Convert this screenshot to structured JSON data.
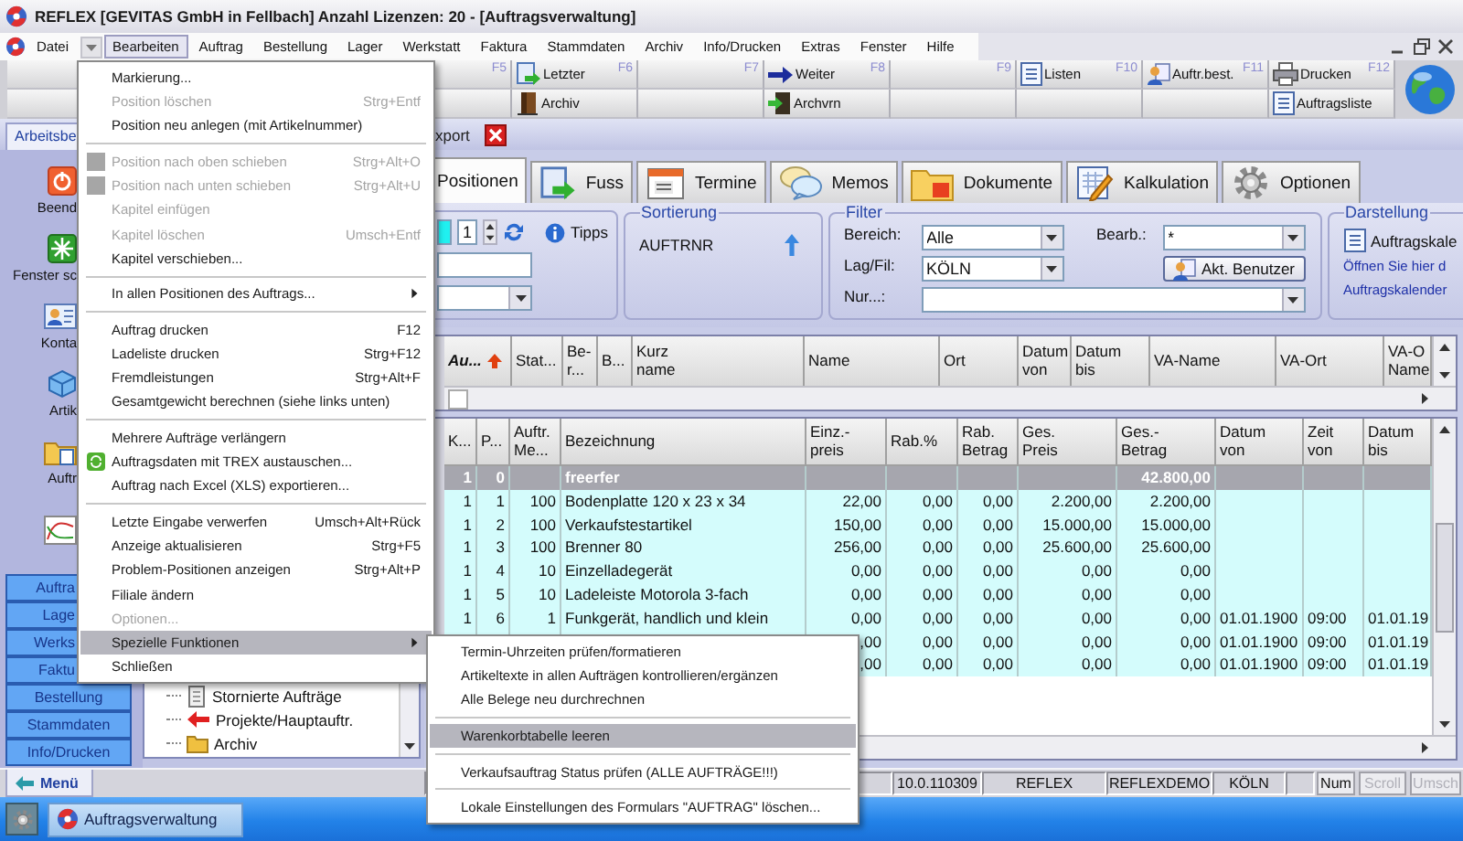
{
  "window": {
    "title": "REFLEX [GEVITAS GmbH in Fellbach] Anzahl Lizenzen: 20 - [Auftragsverwaltung]"
  },
  "menu_bar": {
    "items": [
      {
        "label": "Datei",
        "selected": false
      },
      {
        "label": "Bearbeiten",
        "selected": true
      },
      {
        "label": "Auftrag",
        "selected": false
      },
      {
        "label": "Bestellung",
        "selected": false
      },
      {
        "label": "Lager",
        "selected": false
      },
      {
        "label": "Werkstatt",
        "selected": false
      },
      {
        "label": "Faktura",
        "selected": false
      },
      {
        "label": "Stammdaten",
        "selected": false
      },
      {
        "label": "Archiv",
        "selected": false
      },
      {
        "label": "Info/Drucken",
        "selected": false
      },
      {
        "label": "Extras",
        "selected": false
      },
      {
        "label": "Fenster",
        "selected": false
      },
      {
        "label": "Hilfe",
        "selected": false
      }
    ]
  },
  "toolbar": [
    {
      "key": "F5"
    },
    {
      "key": "F6",
      "top": "Letzter",
      "bottom": "Archiv"
    },
    {
      "key": "F7"
    },
    {
      "key": "F8",
      "top": "Weiter",
      "bottom": "Archvrn"
    },
    {
      "key": "F9"
    },
    {
      "key": "F10",
      "top": "Listen"
    },
    {
      "key": "F11",
      "top": "Auftr.best."
    },
    {
      "key": "F12",
      "top": "Drucken",
      "bottom": "Auftragsliste"
    }
  ],
  "form_bar": {
    "sidebar_tab": "Arbeitsbe",
    "items": [
      "xport"
    ]
  },
  "sidebar": {
    "tools": [
      "Beend",
      "Fenster sc",
      "Konta",
      "Artik",
      "Auftr"
    ],
    "modules": [
      "Auftra",
      "Lage",
      "Werks",
      "Faktu",
      "Bestellung",
      "Stammdaten",
      "Info/Drucken"
    ]
  },
  "tree": {
    "items": [
      "Stornierte Aufträge",
      "Projekte/Hauptauftr.",
      "Archiv"
    ]
  },
  "tabs": [
    {
      "label": "Positionen",
      "selected": true
    },
    {
      "label": "Fuss",
      "selected": false
    },
    {
      "label": "Termine",
      "selected": false
    },
    {
      "label": "Memos",
      "selected": false
    },
    {
      "label": "Dokumente",
      "selected": false
    },
    {
      "label": "Kalkulation",
      "selected": false
    },
    {
      "label": "Optionen",
      "selected": false
    }
  ],
  "quick_panel": {
    "counter": "1",
    "tips": "Tipps"
  },
  "sorting": {
    "title": "Sortierung",
    "field": "AUFTRNR"
  },
  "filter": {
    "title": "Filter",
    "fields": [
      {
        "label": "Bereich:",
        "value": "Alle"
      },
      {
        "label": "Lag/Fil:",
        "value": "KÖLN"
      },
      {
        "label": "Nur...:"
      }
    ],
    "editor": {
      "label": "Bearb.:",
      "value": "*"
    },
    "button": "Akt. Benutzer"
  },
  "display": {
    "title": "Darstellung",
    "link": "Auftragskale",
    "lines": [
      "Öffnen Sie hier d",
      "Auftragskalender"
    ]
  },
  "order_grid": {
    "columns": [
      "Au...",
      "Stat...",
      "Be-\nr...",
      "B...",
      "Kurz\nname",
      "Name",
      "Ort",
      "Datum\nvon",
      "Datum\nbis",
      "VA-Name",
      "VA-Ort",
      "VA-O\nName"
    ]
  },
  "positions_grid": {
    "columns": [
      "K...",
      "P...",
      "Auftr.\nMe...",
      "Bezeichnung",
      "Einz.-\npreis",
      "Rab.%",
      "Rab.\nBetrag",
      "Ges.\nPreis",
      "Ges.-\nBetrag",
      "Datum\nvon",
      "Zeit\nvon",
      "Datum\nbis"
    ],
    "rows": [
      {
        "kind": "group",
        "cells": [
          "1",
          "0",
          null,
          "freerfer",
          null,
          null,
          null,
          null,
          "42.800,00",
          null,
          null,
          null
        ]
      },
      {
        "kind": "position",
        "cells": [
          "1",
          "1",
          "100",
          "Bodenplatte 120 x 23 x 34",
          "22,00",
          "0,00",
          "0,00",
          "2.200,00",
          "2.200,00",
          null,
          null,
          null
        ]
      },
      {
        "kind": "position",
        "cells": [
          "1",
          "2",
          "100",
          "Verkaufstestartikel",
          "150,00",
          "0,00",
          "0,00",
          "15.000,00",
          "15.000,00",
          null,
          null,
          null
        ]
      },
      {
        "kind": "position",
        "cells": [
          "1",
          "3",
          "100",
          "Brenner 80",
          "256,00",
          "0,00",
          "0,00",
          "25.600,00",
          "25.600,00",
          null,
          null,
          null
        ]
      },
      {
        "kind": "position",
        "cells": [
          "1",
          "4",
          "10",
          "Einzelladegerät",
          "0,00",
          "0,00",
          "0,00",
          "0,00",
          "0,00",
          null,
          null,
          null
        ]
      },
      {
        "kind": "position",
        "cells": [
          "1",
          "5",
          "10",
          "Ladeleiste Motorola 3-fach",
          "0,00",
          "0,00",
          "0,00",
          "0,00",
          "0,00",
          null,
          null,
          null
        ]
      },
      {
        "kind": "position",
        "cells": [
          "1",
          "6",
          "1",
          "Funkgerät, handlich und klein",
          "0,00",
          "0,00",
          "0,00",
          "0,00",
          "0,00",
          "01.01.1900",
          "09:00",
          "01.01.19"
        ]
      },
      {
        "kind": "position",
        "cells": [
          null,
          null,
          null,
          null,
          ",00",
          "0,00",
          "0,00",
          "0,00",
          "0,00",
          "01.01.1900",
          "09:00",
          "01.01.19"
        ]
      },
      {
        "kind": "position",
        "cells": [
          null,
          null,
          null,
          null,
          ",00",
          "0,00",
          "0,00",
          "0,00",
          "0,00",
          "01.01.1900",
          "09:00",
          "01.01.19"
        ]
      }
    ]
  },
  "status_bar": {
    "menu_tab": "Menü",
    "cells": [
      {
        "kind": "field",
        "text": "10.0.110309"
      },
      {
        "kind": "field",
        "text": "REFLEX"
      },
      {
        "kind": "field",
        "text": "REFLEXDEMO"
      },
      {
        "kind": "field",
        "text": "KÖLN"
      },
      {
        "kind": "key",
        "text": "Num",
        "disabled": false
      },
      {
        "kind": "key",
        "text": "Scroll",
        "disabled": true
      },
      {
        "kind": "key",
        "text": "Umsch",
        "disabled": true
      }
    ]
  },
  "taskbar": {
    "buttons": [
      "Auftragsverwaltung"
    ]
  },
  "edit_menu": {
    "items": [
      {
        "kind": "item",
        "label": "Markierung...",
        "disabled": false,
        "selected": false,
        "submenu": false
      },
      {
        "kind": "item",
        "label": "Position löschen",
        "shortcut": "Strg+Entf",
        "disabled": true,
        "selected": false,
        "submenu": false
      },
      {
        "kind": "item",
        "label": "Position neu anlegen (mit Artikelnummer)",
        "disabled": false,
        "selected": false,
        "submenu": false
      },
      {
        "kind": "separator"
      },
      {
        "kind": "item",
        "label": "Position nach oben schieben",
        "shortcut": "Strg+Alt+O",
        "disabled": true,
        "selected": false,
        "submenu": false
      },
      {
        "kind": "item",
        "label": "Position nach unten schieben",
        "shortcut": "Strg+Alt+U",
        "disabled": true,
        "selected": false,
        "submenu": false
      },
      {
        "kind": "item",
        "label": "Kapitel einfügen",
        "disabled": true,
        "selected": false,
        "submenu": false
      },
      {
        "kind": "item",
        "label": "Kapitel löschen",
        "shortcut": "Umsch+Entf",
        "disabled": true,
        "selected": false,
        "submenu": false
      },
      {
        "kind": "item",
        "label": "Kapitel verschieben...",
        "disabled": false,
        "selected": false,
        "submenu": false
      },
      {
        "kind": "separator"
      },
      {
        "kind": "item",
        "label": "In allen Positionen des Auftrags...",
        "disabled": false,
        "selected": false,
        "submenu": true
      },
      {
        "kind": "separator"
      },
      {
        "kind": "item",
        "label": "Auftrag drucken",
        "shortcut": "F12",
        "disabled": false,
        "selected": false,
        "submenu": false
      },
      {
        "kind": "item",
        "label": "Ladeliste drucken",
        "shortcut": "Strg+F12",
        "disabled": false,
        "selected": false,
        "submenu": false
      },
      {
        "kind": "item",
        "label": "Fremdleistungen",
        "shortcut": "Strg+Alt+F",
        "disabled": false,
        "selected": false,
        "submenu": false
      },
      {
        "kind": "item",
        "label": "Gesamtgewicht berechnen (siehe links unten)",
        "disabled": false,
        "selected": false,
        "submenu": false
      },
      {
        "kind": "separator"
      },
      {
        "kind": "item",
        "label": "Mehrere Aufträge verlängern",
        "disabled": false,
        "selected": false,
        "submenu": false
      },
      {
        "kind": "item",
        "label": "Auftragsdaten mit TREX austauschen...",
        "disabled": false,
        "selected": false,
        "submenu": false
      },
      {
        "kind": "item",
        "label": "Auftrag nach Excel (XLS) exportieren...",
        "disabled": false,
        "selected": false,
        "submenu": false
      },
      {
        "kind": "separator"
      },
      {
        "kind": "item",
        "label": "Letzte Eingabe verwerfen",
        "shortcut": "Umsch+Alt+Rück",
        "disabled": false,
        "selected": false,
        "submenu": false
      },
      {
        "kind": "item",
        "label": "Anzeige aktualisieren",
        "shortcut": "Strg+F5",
        "disabled": false,
        "selected": false,
        "submenu": false
      },
      {
        "kind": "item",
        "label": "Problem-Positionen anzeigen",
        "shortcut": "Strg+Alt+P",
        "disabled": false,
        "selected": false,
        "submenu": false
      },
      {
        "kind": "item",
        "label": "Filiale ändern",
        "disabled": false,
        "selected": false,
        "submenu": false
      },
      {
        "kind": "item",
        "label": "Optionen...",
        "disabled": true,
        "selected": false,
        "submenu": false
      },
      {
        "kind": "item",
        "label": "Spezielle Funktionen",
        "disabled": false,
        "selected": true,
        "submenu": true
      },
      {
        "kind": "item",
        "label": "Schließen",
        "disabled": false,
        "selected": false,
        "submenu": false
      }
    ]
  },
  "special_menu": {
    "items": [
      {
        "kind": "item",
        "label": "Termin-Uhrzeiten prüfen/formatieren",
        "disabled": false,
        "selected": false,
        "submenu": false
      },
      {
        "kind": "item",
        "label": "Artikeltexte in allen Aufträgen kontrollieren/ergänzen",
        "disabled": false,
        "selected": false,
        "submenu": false
      },
      {
        "kind": "item",
        "label": "Alle Belege neu durchrechnen",
        "disabled": false,
        "selected": false,
        "submenu": false
      },
      {
        "kind": "separator"
      },
      {
        "kind": "item",
        "label": "Warenkorbtabelle leeren",
        "disabled": false,
        "selected": true,
        "submenu": false
      },
      {
        "kind": "separator"
      },
      {
        "kind": "item",
        "label": "Verkaufsauftrag Status prüfen (ALLE AUFTRÄGE!!!)",
        "disabled": false,
        "selected": false,
        "submenu": false
      },
      {
        "kind": "separator"
      },
      {
        "kind": "item",
        "label": "Lokale Einstellungen des Formulars \"AUFTRAG\" löschen...",
        "disabled": false,
        "selected": false,
        "submenu": false
      }
    ]
  }
}
